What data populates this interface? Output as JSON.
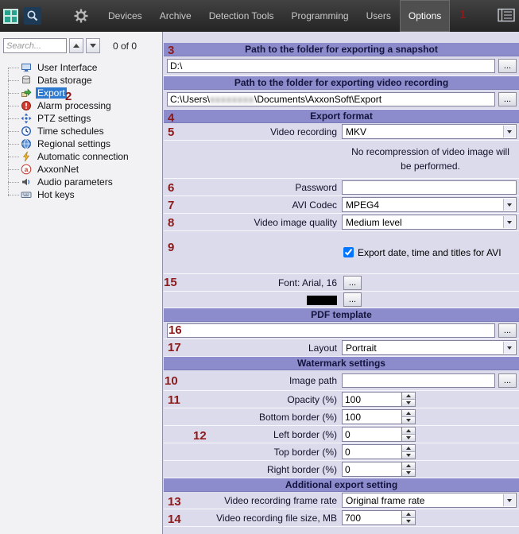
{
  "toolbar": {
    "menu": [
      {
        "label": "Devices"
      },
      {
        "label": "Archive"
      },
      {
        "label": "Detection Tools"
      },
      {
        "label": "Programming"
      },
      {
        "label": "Users"
      },
      {
        "label": "Options"
      }
    ]
  },
  "sidebar": {
    "search": {
      "placeholder": "Search...",
      "counter": "0 of 0"
    },
    "items": [
      {
        "label": "User Interface"
      },
      {
        "label": "Data storage"
      },
      {
        "label": "Export"
      },
      {
        "label": "Alarm processing"
      },
      {
        "label": "PTZ settings"
      },
      {
        "label": "Time schedules"
      },
      {
        "label": "Regional settings"
      },
      {
        "label": "Automatic connection"
      },
      {
        "label": "AxxonNet"
      },
      {
        "label": "Audio parameters"
      },
      {
        "label": "Hot keys"
      }
    ]
  },
  "labels": {
    "browse": "..."
  },
  "panel": {
    "snapshot": {
      "header": "Path to the folder for exporting a snapshot",
      "value": "D:\\"
    },
    "recording": {
      "header": "Path to the folder for exporting video recording",
      "prefix": "C:\\Users\\",
      "redacted": "xxxxxxxx",
      "suffix": "\\Documents\\AxxonSoft\\Export"
    },
    "export_format": {
      "header": "Export format",
      "video_recording_label": "Video recording",
      "video_recording_value": "MKV",
      "note": "No recompression of video image will be performed.",
      "password_label": "Password",
      "password_value": "",
      "avi_codec_label": "AVI Codec",
      "avi_codec_value": "MPEG4",
      "quality_label": "Video image quality",
      "quality_value": "Medium level",
      "checkbox_label": "Export date, time and titles for AVI",
      "font_label": "Font: Arial, 16",
      "font_color": "#000000"
    },
    "pdf": {
      "header": "PDF template",
      "template_value": "",
      "layout_label": "Layout",
      "layout_value": "Portrait"
    },
    "watermark": {
      "header": "Watermark settings",
      "image_path_label": "Image path",
      "image_path_value": "",
      "opacity_label": "Opacity (%)",
      "opacity_value": "100",
      "bottom_label": "Bottom border (%)",
      "bottom_value": "100",
      "left_label": "Left border (%)",
      "left_value": "0",
      "top_label": "Top border (%)",
      "top_value": "0",
      "right_label": "Right border (%)",
      "right_value": "0"
    },
    "additional": {
      "header": "Additional export setting",
      "frame_rate_label": "Video recording frame rate",
      "frame_rate_value": "Original frame rate",
      "file_size_label": "Video recording file size, MB",
      "file_size_value": "700"
    }
  },
  "annotations": [
    "1",
    "2",
    "3",
    "4",
    "5",
    "6",
    "7",
    "8",
    "9",
    "10",
    "11",
    "12",
    "13",
    "14",
    "15",
    "16",
    "17"
  ]
}
